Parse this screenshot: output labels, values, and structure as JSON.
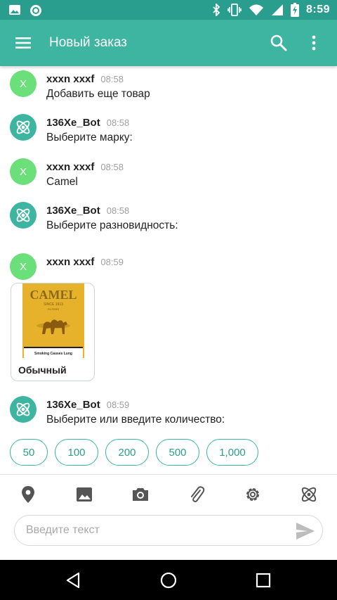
{
  "status_bar": {
    "time": "8:59",
    "left_icons": [
      "image-icon",
      "circle-notification-icon"
    ],
    "right_icons": [
      "bluetooth-icon",
      "vibrate-icon",
      "wifi-icon",
      "signal-icon",
      "battery-charging-icon"
    ]
  },
  "app_bar": {
    "title": "Новый заказ",
    "menu_icon": "hamburger-menu-icon",
    "search_icon": "search-icon",
    "more_icon": "more-vertical-icon"
  },
  "colors": {
    "status_bar": "#2a9e8e",
    "app_bar": "#3db5a1",
    "user_avatar": "#6be07a",
    "accent": "#3db5a1"
  },
  "messages": [
    {
      "sender": "xxxn xxxf",
      "time": "08:58",
      "text": "Добавить еще товар",
      "avatar": "X",
      "type": "user"
    },
    {
      "sender": "136Xe_Bot",
      "time": "08:58",
      "text": "Выберите марку:",
      "avatar": "",
      "type": "bot"
    },
    {
      "sender": "xxxn xxxf",
      "time": "08:58",
      "text": "Camel",
      "avatar": "X",
      "type": "user"
    },
    {
      "sender": "136Xe_Bot",
      "time": "08:58",
      "text": "Выберите разновидность:",
      "avatar": "",
      "type": "bot"
    },
    {
      "sender": "xxxn xxxf",
      "time": "08:59",
      "text": "",
      "avatar": "X",
      "type": "user"
    },
    {
      "sender": "136Xe_Bot",
      "time": "08:59",
      "text": "Выберите или введите количество:",
      "avatar": "",
      "type": "bot"
    }
  ],
  "product_card": {
    "caption": "Обычный",
    "brand_text": "CAMEL",
    "since_text": "SINCE 1913",
    "filters_text": "FILTERS",
    "warning_text": "Smoking Causes Lung"
  },
  "quantity_options": [
    "50",
    "100",
    "200",
    "500",
    "1,000"
  ],
  "toolbar": [
    "location-pin-icon",
    "image-icon",
    "camera-icon",
    "attachment-clip-icon",
    "settings-gear-icon",
    "bot-atom-icon"
  ],
  "input": {
    "placeholder": "Введите текст",
    "value": "",
    "send_icon": "send-icon"
  },
  "nav": [
    "back-triangle-icon",
    "home-circle-icon",
    "recents-square-icon"
  ]
}
